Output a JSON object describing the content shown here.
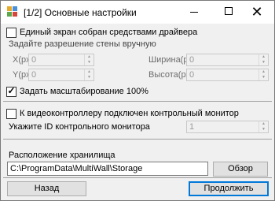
{
  "window": {
    "title": "[1/2] Основные настройки",
    "controls": {
      "minimize": "minimize",
      "maximize": "maximize",
      "close": "✕"
    }
  },
  "driver_screen": {
    "label": "Единый экран собран средствами драйвера",
    "checked": false
  },
  "resolution": {
    "heading": "Задайте разрешение стены вручную",
    "x": {
      "label": "X(px)",
      "value": "0"
    },
    "y": {
      "label": "Y(px)",
      "value": "0"
    },
    "width": {
      "label": "Ширина(px)",
      "value": "0"
    },
    "height": {
      "label": "Высота(px)",
      "value": "0"
    }
  },
  "scaling": {
    "label": "Задать масштабирование 100%",
    "checked": true,
    "check_glyph": "✓"
  },
  "monitor": {
    "label": "К видеоконтроллеру подключен контрольный монитор",
    "checked": false,
    "id_label": "Укажите ID контрольного монитора",
    "id_value": "1"
  },
  "storage": {
    "label": "Расположение хранилища",
    "path": "C:\\ProgramData\\MultiWall\\Storage",
    "browse_label": "Обзор"
  },
  "footer": {
    "back_label": "Назад",
    "next_label": "Продолжить"
  },
  "colors": {
    "accent": "#0078d7",
    "client_bg": "#f0f0f0"
  }
}
